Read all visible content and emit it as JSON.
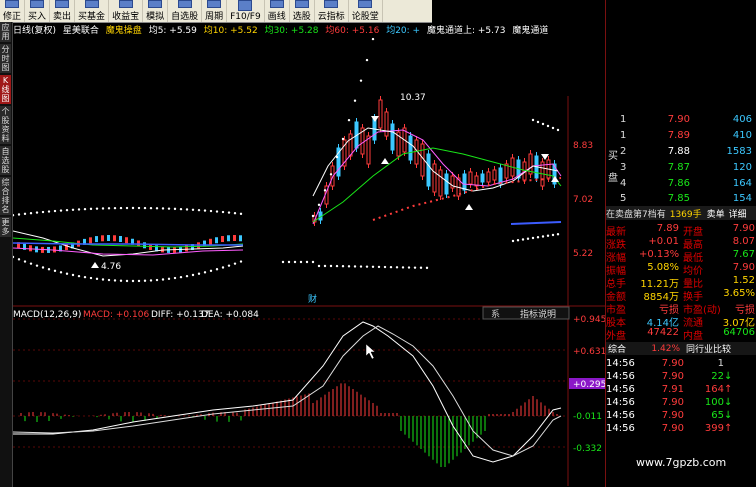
{
  "toolbar": [
    {
      "label": "修正",
      "icon": "edit-icon"
    },
    {
      "label": "买入",
      "icon": "buy-icon"
    },
    {
      "label": "卖出",
      "icon": "sell-icon"
    },
    {
      "label": "买基金",
      "icon": "fund-icon"
    },
    {
      "label": "收益宝",
      "icon": "wallet-icon"
    },
    {
      "label": "模拟",
      "icon": "simulate-icon"
    },
    {
      "label": "自选股",
      "icon": "star-icon"
    },
    {
      "label": "周期",
      "icon": "period-icon"
    },
    {
      "label": "F10/F9",
      "icon": "info-icon"
    },
    {
      "label": "画线",
      "icon": "draw-icon"
    },
    {
      "label": "选股",
      "icon": "filter-icon"
    },
    {
      "label": "云指标",
      "icon": "cloud-icon"
    },
    {
      "label": "论股堂",
      "icon": "chat-icon"
    }
  ],
  "sidebar": [
    "应用",
    "分时图",
    "K线图",
    "个股资料",
    "自选股",
    "综合排名",
    "更多"
  ],
  "indicator_row": {
    "period": "日线(复权)",
    "stock": "星美联合",
    "formula": "魔鬼操盘",
    "ma5": "均5: +5.59",
    "ma10": "均10: +5.52",
    "ma30": "均30: +5.28",
    "ma60": "均60: +5.16",
    "ma_trunc": "均20: +",
    "ch_upper": "魔鬼通道上: +5.73",
    "ch_mid": "魔鬼通道"
  },
  "price_labels": {
    "p1": "8.83",
    "p2": "7.02",
    "p3": "5.22",
    "high": "10.37",
    "low": "4.76",
    "fin": "财"
  },
  "macd": {
    "header": "MACD(12,26,9)",
    "macd": "MACD: +0.106",
    "diff": "DIFF: +0.137",
    "dea": "DEA: +0.084",
    "tab_left": "系",
    "tab": "指标说明",
    "axis": [
      "+0.945",
      "+0.631",
      "+0.295",
      "-0.011",
      "-0.332"
    ]
  },
  "order_book": {
    "side_buy": "买盘",
    "rows": [
      {
        "n": "1",
        "price": "7.90",
        "vol": "406"
      },
      {
        "n": "1",
        "price": "7.89",
        "vol": "410"
      },
      {
        "n": "2",
        "price": "7.88",
        "vol": "1583"
      },
      {
        "n": "3",
        "price": "7.87",
        "vol": "120"
      },
      {
        "n": "4",
        "price": "7.86",
        "vol": "164"
      },
      {
        "n": "5",
        "price": "7.85",
        "vol": "154"
      }
    ]
  },
  "bar": {
    "left": "在卖盘第7档有",
    "count": "1369手",
    "tab1": "卖单",
    "tab2": "详细"
  },
  "quotes": [
    {
      "k1": "最新",
      "v1": "7.89",
      "k2": "开盘",
      "v2": "7.90"
    },
    {
      "k1": "涨跌",
      "v1": "+0.01",
      "k2": "最高",
      "v2": "8.07"
    },
    {
      "k1": "涨幅",
      "v1": "+0.13%",
      "k2": "最低",
      "v2": "7.67"
    },
    {
      "k1": "振幅",
      "v1": "5.08%",
      "k2": "均价",
      "v2": "7.90"
    },
    {
      "k1": "总手",
      "v1": "11.21万",
      "k2": "量比",
      "v2": "1.52"
    },
    {
      "k1": "金额",
      "v1": "8854万",
      "k2": "换手",
      "v2": "3.65%"
    },
    {
      "k1": "市盈",
      "v1": "亏损",
      "k2": "市盈(动)",
      "v2": "亏损"
    },
    {
      "k1": "股本",
      "v1": "4.14亿",
      "k2": "流通",
      "v2": "3.07亿"
    },
    {
      "k1": "外盘",
      "v1": "47422",
      "k2": "内盘",
      "v2": "64706"
    }
  ],
  "tabs": {
    "t1": "综合",
    "pct": "1.42%",
    "t2": "同行业比较"
  },
  "ticks": [
    {
      "t": "14:56",
      "p": "7.90",
      "v": "1",
      "d": ""
    },
    {
      "t": "14:56",
      "p": "7.90",
      "v": "22",
      "d": "down"
    },
    {
      "t": "14:56",
      "p": "7.91",
      "v": "164",
      "d": "up"
    },
    {
      "t": "14:56",
      "p": "7.90",
      "v": "100",
      "d": "down"
    },
    {
      "t": "14:56",
      "p": "7.90",
      "v": "65",
      "d": "down"
    },
    {
      "t": "14:56",
      "p": "7.90",
      "v": "399",
      "d": "up"
    }
  ],
  "watermark": "www.7gpzb.com",
  "colors": {
    "up": "#ff3c3c",
    "down": "#19e619",
    "bg": "#000000",
    "grid": "#7a1010"
  }
}
